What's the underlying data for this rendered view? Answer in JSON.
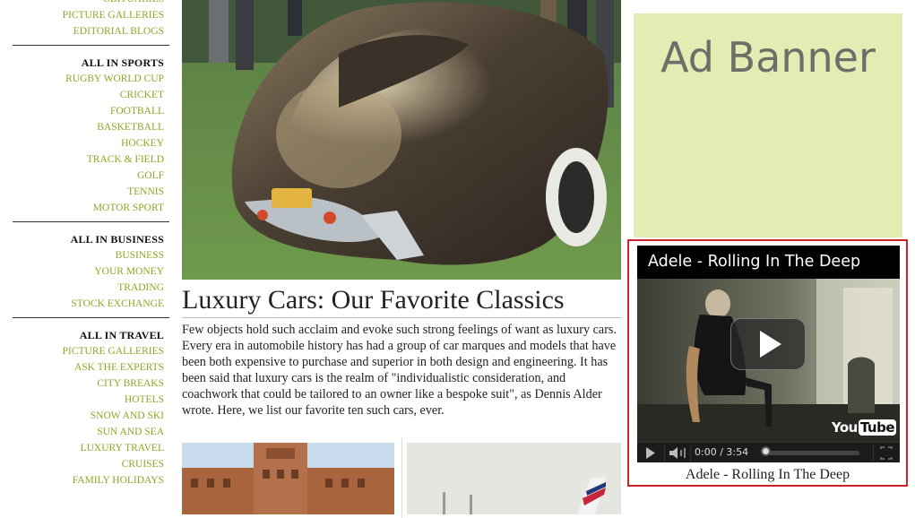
{
  "sidebar": {
    "groups": [
      {
        "head": "",
        "links": [
          "OBITUARIES",
          "PICTURE GALLERIES",
          "EDITORIAL BLOGS"
        ]
      },
      {
        "head": "ALL IN SPORTS",
        "links": [
          "RUGBY WORLD CUP",
          "CRICKET",
          "FOOTBALL",
          "BASKETBALL",
          "HOCKEY",
          "TRACK & FIELD",
          "GOLF",
          "TENNIS",
          "MOTOR SPORT"
        ]
      },
      {
        "head": "ALL IN BUSINESS",
        "links": [
          "BUSINESS",
          "YOUR MONEY",
          "TRADING",
          "STOCK EXCHANGE"
        ]
      },
      {
        "head": "ALL IN TRAVEL",
        "links": [
          "PICTURE GALLERIES",
          "ASK THE EXPERTS",
          "CITY BREAKS",
          "HOTELS",
          "SNOW AND SKI",
          "SUN AND SEA",
          "LUXURY TRAVEL",
          "CRUISES",
          "FAMILY HOLIDAYS"
        ]
      }
    ]
  },
  "article": {
    "headline": "Luxury Cars: Our Favorite Classics",
    "body": "Few objects hold such acclaim and evoke such strong feelings of want as luxury cars. Every era in automobile history has had a group of car marques and models that have been both expensive to purchase and superior in both design and engineering. It has been said that luxury cars is the realm of \"individualistic consideration, and coachwork that could be tailored to an owner like a bespoke suit\", as Dennis Alder wrote. Here, we list our favorite ten such cars, ever."
  },
  "ad": {
    "label": "Ad Banner",
    "color": "#e3edb3"
  },
  "video": {
    "title": "Adele - Rolling In The Deep",
    "time": "0:00 / 3:54",
    "logo_you": "You",
    "logo_tube": "Tube",
    "caption": "Adele - Rolling In The Deep",
    "progress": 0,
    "border_color": "#d0202a"
  },
  "colors": {
    "link": "#8aa826"
  }
}
